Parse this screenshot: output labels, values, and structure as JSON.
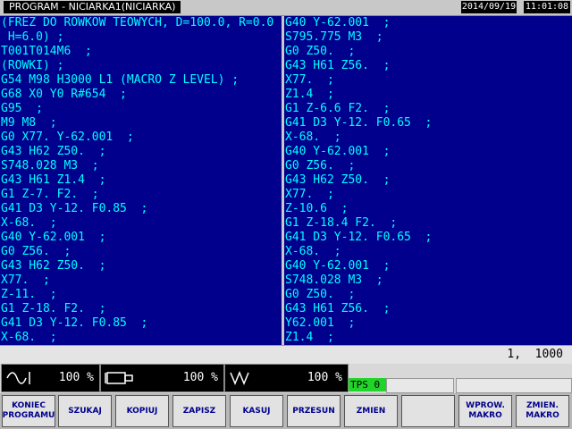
{
  "header": {
    "title": "PROGRAM - NICIARKA1(NICIARKA)",
    "date": "2014/09/19",
    "time": "11:01:08"
  },
  "program": {
    "left": [
      "(FREZ DO ROWKOW TEOWYCH, D=100.0, R=0.0",
      " H=6.0) ;",
      "T001T014M6  ;",
      "(ROWKI) ;",
      "G54 M98 H3000 L1 (MACRO Z LEVEL) ;",
      "G68 X0 Y0 R#654  ;",
      "G95  ;",
      "M9 M8  ;",
      "G0 X77. Y-62.001  ;",
      "G43 H62 Z50.  ;",
      "S748.028 M3  ;",
      "G43 H61 Z1.4  ;",
      "G1 Z-7. F2.  ;",
      "G41 D3 Y-12. F0.85  ;",
      "X-68.  ;",
      "G40 Y-62.001  ;",
      "G0 Z56.  ;",
      "G43 H62 Z50.  ;",
      "X77.  ;",
      "Z-11.  ;",
      "G1 Z-18. F2.  ;",
      "G41 D3 Y-12. F0.85  ;",
      "X-68.  ;"
    ],
    "right": [
      "G40 Y-62.001  ;",
      "S795.775 M3  ;",
      "G0 Z50.  ;",
      "G43 H61 Z56.  ;",
      "X77.  ;",
      "Z1.4  ;",
      "G1 Z-6.6 F2.  ;",
      "G41 D3 Y-12. F0.65  ;",
      "X-68.  ;",
      "G40 Y-62.001  ;",
      "G0 Z56.  ;",
      "G43 H62 Z50.  ;",
      "X77.  ;",
      "Z-10.6  ;",
      "G1 Z-18.4 F2.  ;",
      "G41 D3 Y-12. F0.65  ;",
      "X-68.  ;",
      "G40 Y-62.001  ;",
      "S748.028 M3  ;",
      "G0 Z50.  ;",
      "G43 H61 Z56.  ;",
      "Y62.001  ;",
      "Z1.4  ;"
    ]
  },
  "status": {
    "text": "1,  1000"
  },
  "overrides": {
    "spindle": {
      "icon": "spindle-wave-icon",
      "value": "100 %"
    },
    "feed": {
      "icon": "tool-holder-icon",
      "value": "100 %"
    },
    "rapid": {
      "icon": "rapid-zigzag-icon",
      "value": "100 %"
    }
  },
  "tps": "TPS 0",
  "softkeys": {
    "k1": "KONIEC\nPROGRAMU",
    "k2": "SZUKAJ",
    "k3": "KOPIUJ",
    "k4": "ZAPISZ",
    "k5": "KASUJ",
    "k6": "PRZESUN",
    "k7": "ZMIEN",
    "k8": "",
    "k9": "WPROW.\nMAKRO",
    "k10": "ZMIEN.\nMAKRO"
  },
  "colors": {
    "editor_bg": "#00008c",
    "code_text": "#00ffff",
    "tps_bg": "#22d42a"
  }
}
